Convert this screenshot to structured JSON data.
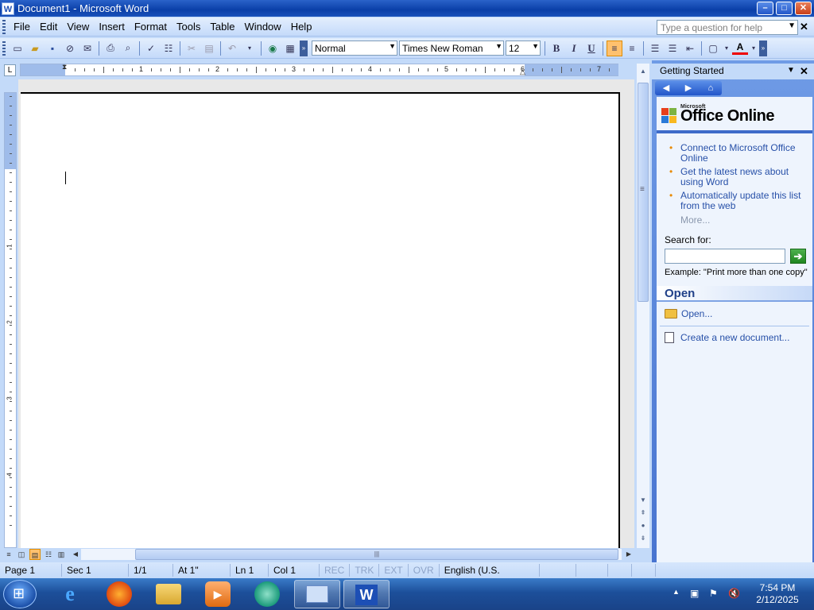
{
  "window": {
    "title": "Document1 - Microsoft Word",
    "app_icon": "W",
    "controls": {
      "minimize": "–",
      "maximize": "□",
      "close": "✕"
    }
  },
  "menubar": {
    "items": [
      "File",
      "Edit",
      "View",
      "Insert",
      "Format",
      "Tools",
      "Table",
      "Window",
      "Help"
    ],
    "help_placeholder": "Type a question for help",
    "help_close": "✕"
  },
  "toolbar": {
    "style": "Normal",
    "font": "Times New Roman",
    "size": "12",
    "bold": "B",
    "italic": "I",
    "underline": "U",
    "font_color_label": "A"
  },
  "ruler": {
    "corner": "L",
    "numbers": [
      "1",
      "2",
      "3",
      "4",
      "5",
      "6",
      "7"
    ],
    "vertical_numbers": [
      "1",
      "2",
      "3",
      "4"
    ]
  },
  "status": {
    "page": "Page  1",
    "sec": "Sec  1",
    "pages": "1/1",
    "at": "At  1\"",
    "ln": "Ln  1",
    "col": "Col  1",
    "rec": "REC",
    "trk": "TRK",
    "ext": "EXT",
    "ovr": "OVR",
    "language": "English (U.S."
  },
  "task_pane": {
    "title": "Getting Started",
    "logo_small": "Microsoft",
    "logo_big": "Office Online",
    "links": [
      "Connect to Microsoft Office Online",
      "Get the latest news about using Word",
      "Automatically update this list from the web"
    ],
    "more": "More...",
    "search_label": "Search for:",
    "search_value": "",
    "example": "Example:  \"Print more than one copy\"",
    "open_heading": "Open",
    "open_link": "Open...",
    "new_doc_link": "Create a new document..."
  },
  "taskbar": {
    "time": "7:54 PM",
    "date": "2/12/2025"
  }
}
